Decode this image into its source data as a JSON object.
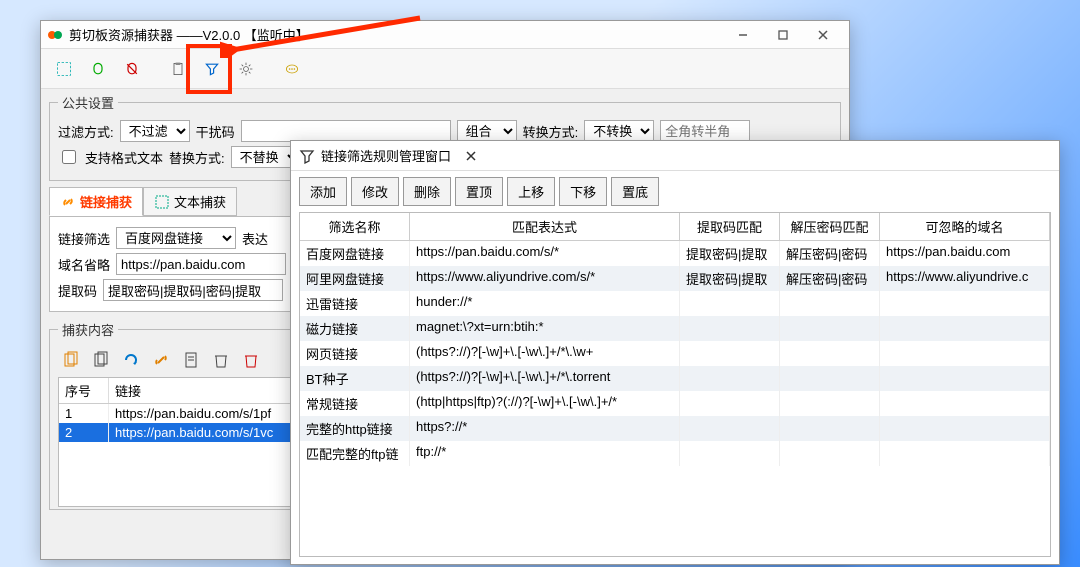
{
  "main": {
    "title": "剪切板资源捕获器   ——V2.0.0  【监听中】",
    "group_public": "公共设置",
    "filter_label": "过滤方式:",
    "filter_value": "不过滤",
    "disturb_label": "干扰码",
    "combo_label": "组合",
    "convert_label": "转换方式:",
    "convert_value": "不转换",
    "fullhalf_placeholder": "全角转半角",
    "format_text_label": "支持格式文本",
    "replace_label": "替换方式:",
    "replace_value": "不替换",
    "tab_link": "链接捕获",
    "tab_text": "文本捕获",
    "link_filter_label": "链接筛选",
    "link_filter_value": "百度网盘链接",
    "expr_label": "表达",
    "domain_label": "域名省略",
    "domain_value": "https://pan.baidu.com",
    "extract_label": "提取码",
    "extract_value": "提取密码|提取码|密码|提取",
    "captured_title": "捕获内容",
    "grid": {
      "col_seq": "序号",
      "col_link": "链接",
      "rows": [
        {
          "seq": "1",
          "link": "https://pan.baidu.com/s/1pf"
        },
        {
          "seq": "2",
          "link": "https://pan.baidu.com/s/1vc"
        }
      ]
    }
  },
  "dialog": {
    "title": "链接筛选规则管理窗口",
    "buttons": {
      "add": "添加",
      "edit": "修改",
      "del": "删除",
      "top": "置顶",
      "up": "上移",
      "down": "下移",
      "bottom": "置底"
    },
    "columns": {
      "name": "筛选名称",
      "expr": "匹配表达式",
      "ext": "提取码匹配",
      "dec": "解压密码匹配",
      "dom": "可忽略的域名"
    },
    "rows": [
      {
        "name": "百度网盘链接",
        "expr": "https://pan.baidu.com/s/*",
        "ext": "提取密码|提取",
        "dec": "解压密码|密码",
        "dom": "https://pan.baidu.com"
      },
      {
        "name": "阿里网盘链接",
        "expr": "https://www.aliyundrive.com/s/*",
        "ext": "提取密码|提取",
        "dec": "解压密码|密码",
        "dom": "https://www.aliyundrive.c"
      },
      {
        "name": "迅雷链接",
        "expr": "hunder://*",
        "ext": "",
        "dec": "",
        "dom": ""
      },
      {
        "name": "磁力链接",
        "expr": "magnet:\\?xt=urn:btih:*",
        "ext": "",
        "dec": "",
        "dom": ""
      },
      {
        "name": "网页链接",
        "expr": "(https?://)?[-\\w]+\\.[-\\w\\.]+/*\\.\\w+",
        "ext": "",
        "dec": "",
        "dom": ""
      },
      {
        "name": "BT种子",
        "expr": "(https?://)?[-\\w]+\\.[-\\w\\.]+/*\\.torrent",
        "ext": "",
        "dec": "",
        "dom": ""
      },
      {
        "name": "常规链接",
        "expr": "(http|https|ftp)?(://)?[-\\w]+\\.[-\\w\\.]+/*",
        "ext": "",
        "dec": "",
        "dom": ""
      },
      {
        "name": "完整的http链接",
        "expr": "https?://*",
        "ext": "",
        "dec": "",
        "dom": ""
      },
      {
        "name": "匹配完整的ftp链",
        "expr": "ftp://*",
        "ext": "",
        "dec": "",
        "dom": ""
      }
    ]
  }
}
